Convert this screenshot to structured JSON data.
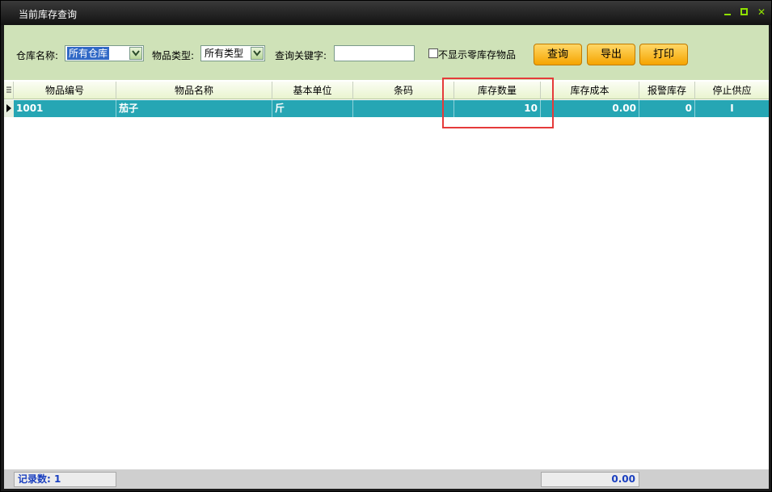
{
  "window": {
    "title": "当前库存查询",
    "controls": [
      "minimize",
      "maximize",
      "close"
    ]
  },
  "toolbar": {
    "warehouse_label": "仓库名称:",
    "warehouse_value": "所有仓库",
    "type_label": "物品类型:",
    "type_value": "所有类型",
    "keyword_label": "查询关键字:",
    "keyword_value": "",
    "hide_zero_label": "不显示零库存物品",
    "hide_zero_checked": false,
    "query_button": "查询",
    "export_button": "导出",
    "print_button": "打印"
  },
  "grid": {
    "columns": [
      "物品编号",
      "物品名称",
      "基本单位",
      "条码",
      "库存数量",
      "库存成本",
      "报警库存",
      "停止供应"
    ],
    "rows": [
      {
        "code": "1001",
        "name": "茄子",
        "unit": "斤",
        "barcode": "",
        "quantity": "10",
        "cost": "0.00",
        "alarm": "0",
        "stop_supply": "I"
      }
    ],
    "highlighted_column": "库存数量"
  },
  "footer": {
    "record_count": "记录数: 1",
    "cost_total": "0.00"
  },
  "colors": {
    "toolbar_bg": "#cfe2b8",
    "selected_row": "#26a6b4",
    "button": "#f5a400",
    "highlight": "#e53a3a",
    "footer_text": "#1a3fbf"
  }
}
